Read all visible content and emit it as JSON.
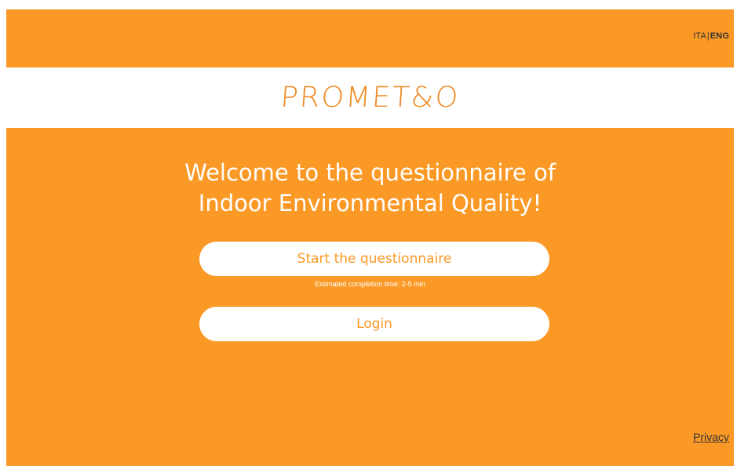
{
  "header": {
    "lang_ita": "ITA",
    "lang_separator": "|",
    "lang_eng": "ENG",
    "active_language": "ENG"
  },
  "brand": {
    "logo_text": "PROMET&O"
  },
  "main": {
    "welcome_line1": "Welcome to the questionnaire of",
    "welcome_line2": "Indoor Environmental Quality!",
    "start_button_label": "Start the questionnaire",
    "completion_note": "Estimated completion time: 2-5 min",
    "login_button_label": "Login"
  },
  "footer": {
    "privacy_link": "Privacy"
  },
  "colors": {
    "accent_orange": "#fb9926",
    "logo_orange": "#f08a24",
    "white": "#ffffff",
    "dark_text": "#333333"
  }
}
